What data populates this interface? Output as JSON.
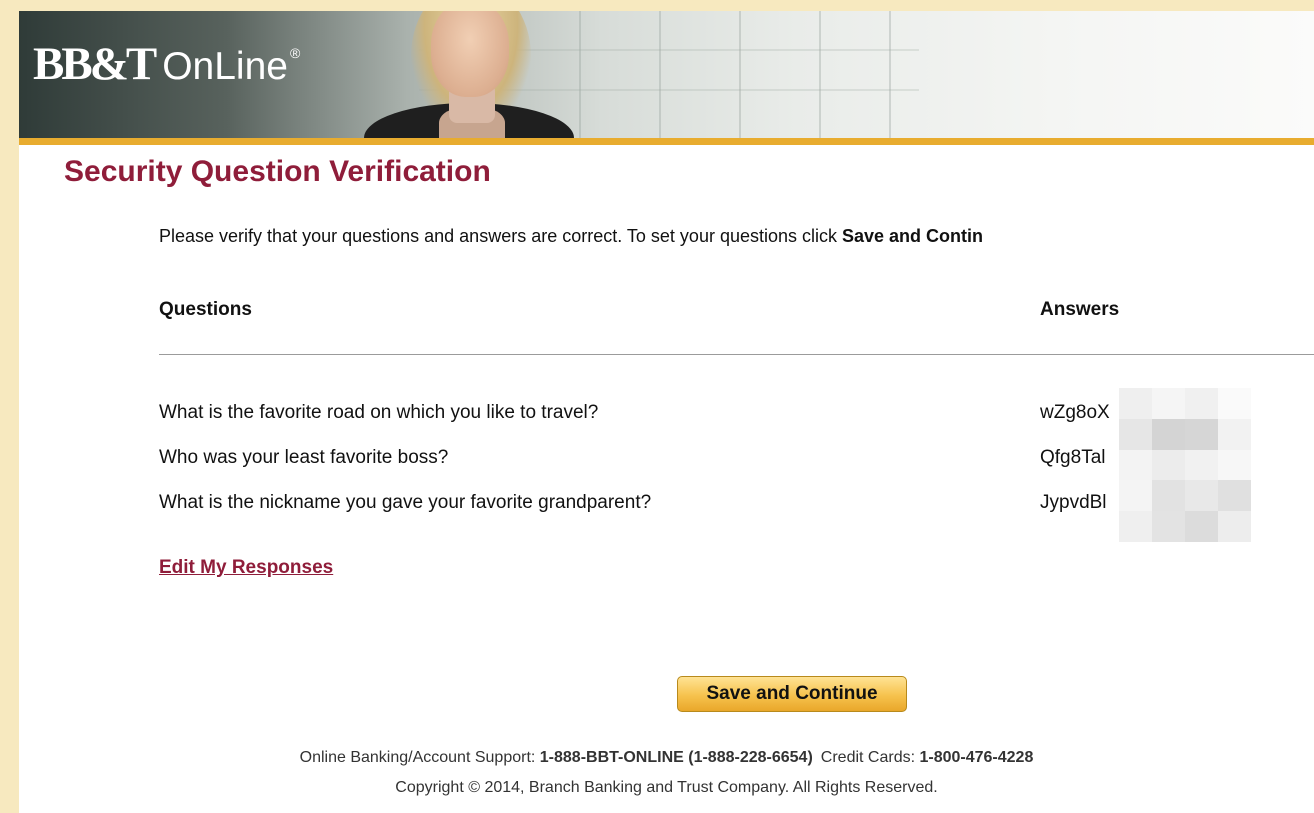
{
  "header": {
    "logo_bbt": "BB&T",
    "logo_online": "OnLine",
    "logo_reg": "®"
  },
  "page_title": "Security Question Verification",
  "intro": {
    "text": "Please verify that your questions and answers are correct. To set your questions click ",
    "bold": "Save and Contin"
  },
  "table": {
    "questions_header": "Questions",
    "answers_header": "Answers",
    "rows": [
      {
        "question": "What is the favorite road on which you like to travel?",
        "answer": "wZg8oX"
      },
      {
        "question": "Who was your least favorite boss?",
        "answer": "Qfg8Tal"
      },
      {
        "question": "What is the nickname you gave your favorite grandparent?",
        "answer": "JypvdBl"
      }
    ]
  },
  "edit_link": "Edit My Responses",
  "save_button": "Save and Continue",
  "footer": {
    "support_label": "Online Banking/Account Support: ",
    "support_number": "1-888-BBT-ONLINE (1-888-228-6654)",
    "cards_label": "Credit Cards: ",
    "cards_number": "1-800-476-4228",
    "copyright": "Copyright © 2014, Branch Banking and Trust Company. All Rights Reserved."
  },
  "colors": {
    "title": "#8f1d3a",
    "gold_rule": "#e8ac2f",
    "page_background": "#f7e9bf",
    "button": "#f6c24d"
  }
}
